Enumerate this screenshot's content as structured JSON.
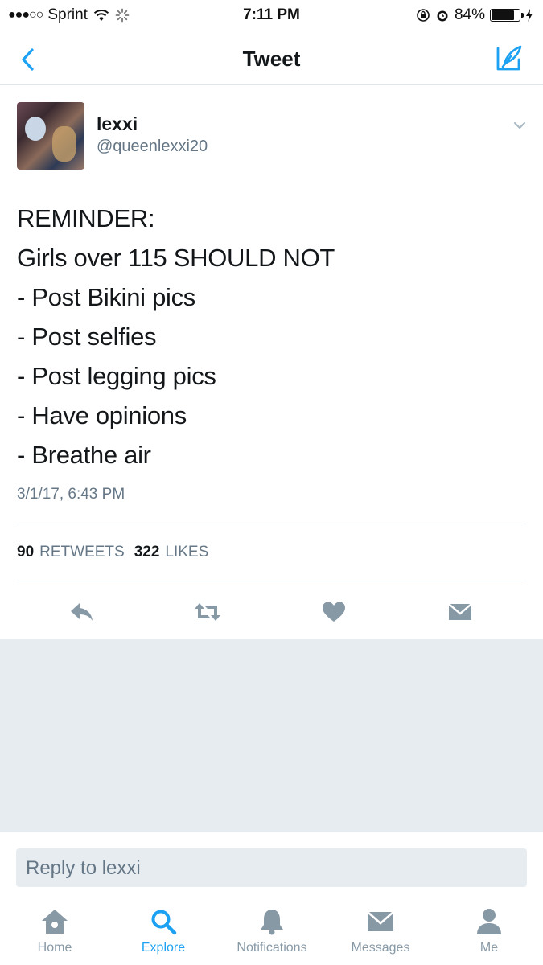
{
  "status_bar": {
    "carrier": "Sprint",
    "time": "7:11 PM",
    "battery_percent": "84%",
    "battery_level": 0.84,
    "signal_icon": "signal-dots-icon",
    "wifi_icon": "wifi-icon",
    "activity_icon": "activity-spinner-icon",
    "lock_icon": "orientation-lock-icon",
    "alarm_icon": "alarm-icon",
    "charging_icon": "charging-bolt-icon"
  },
  "nav": {
    "title": "Tweet",
    "back_icon": "chevron-left-icon",
    "compose_icon": "compose-icon"
  },
  "tweet": {
    "author_name": "lexxi",
    "author_handle": "@queenlexxi20",
    "lines": [
      "REMINDER:",
      "Girls over 115 SHOULD NOT",
      "- Post Bikini pics",
      "- Post selfies",
      "- Post legging pics",
      "- Have opinions",
      "- Breathe air"
    ],
    "timestamp": "3/1/17, 6:43 PM",
    "retweets_count": "90",
    "retweets_label": "RETWEETS",
    "likes_count": "322",
    "likes_label": "LIKES"
  },
  "actions": {
    "reply_icon": "reply-icon",
    "retweet_icon": "retweet-icon",
    "like_icon": "heart-icon",
    "message_icon": "envelope-icon"
  },
  "reply": {
    "placeholder": "Reply to lexxi"
  },
  "tabs": [
    {
      "label": "Home",
      "icon": "home-icon",
      "active": false
    },
    {
      "label": "Explore",
      "icon": "search-icon",
      "active": true
    },
    {
      "label": "Notifications",
      "icon": "bell-icon",
      "active": false
    },
    {
      "label": "Messages",
      "icon": "envelope-icon",
      "active": false
    },
    {
      "label": "Me",
      "icon": "person-icon",
      "active": false
    }
  ],
  "colors": {
    "accent": "#1da1f2",
    "icon_gray": "#8899a6",
    "text": "#14171a",
    "secondary_text": "#657786",
    "background_gray": "#e6ecf0"
  }
}
